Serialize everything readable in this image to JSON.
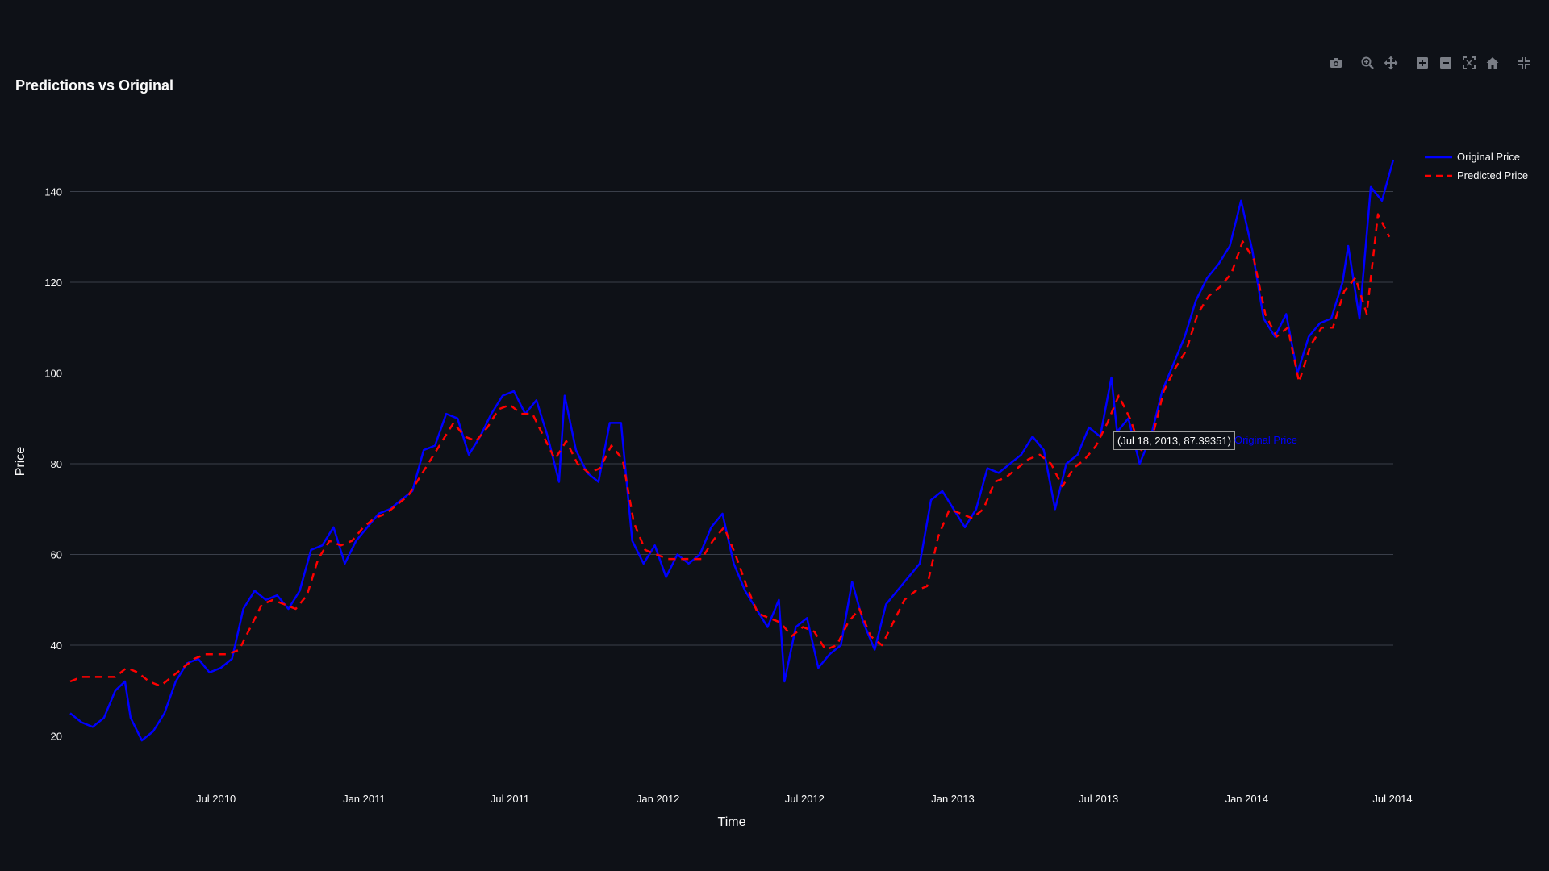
{
  "chart_data": {
    "type": "line",
    "title": "Predictions vs Original",
    "xlabel": "Time",
    "ylabel": "Price",
    "xlim": [
      "2010-01-01",
      "2014-07-02"
    ],
    "ylim": [
      16,
      152
    ],
    "grid": true,
    "legend_position": "top-right",
    "x_ticks": [
      {
        "date": "2010-07-01",
        "label": "Jul 2010"
      },
      {
        "date": "2011-01-01",
        "label": "Jan 2011"
      },
      {
        "date": "2011-07-01",
        "label": "Jul 2011"
      },
      {
        "date": "2012-01-01",
        "label": "Jan 2012"
      },
      {
        "date": "2012-07-01",
        "label": "Jul 2012"
      },
      {
        "date": "2013-01-01",
        "label": "Jan 2013"
      },
      {
        "date": "2013-07-01",
        "label": "Jul 2013"
      },
      {
        "date": "2014-01-01",
        "label": "Jan 2014"
      },
      {
        "date": "2014-07-01",
        "label": "Jul 2014"
      }
    ],
    "y_ticks": [
      20,
      40,
      60,
      80,
      100,
      120,
      140
    ],
    "series": [
      {
        "name": "Original Price",
        "color": "#0000ff",
        "dash": "solid",
        "points": [
          [
            "2010-01-01",
            25
          ],
          [
            "2010-01-15",
            23
          ],
          [
            "2010-01-29",
            22
          ],
          [
            "2010-02-12",
            24
          ],
          [
            "2010-02-26",
            30
          ],
          [
            "2010-03-10",
            32
          ],
          [
            "2010-03-17",
            24
          ],
          [
            "2010-03-31",
            19
          ],
          [
            "2010-04-14",
            21
          ],
          [
            "2010-04-28",
            25
          ],
          [
            "2010-05-12",
            32
          ],
          [
            "2010-05-26",
            36
          ],
          [
            "2010-06-09",
            37
          ],
          [
            "2010-06-23",
            34
          ],
          [
            "2010-07-07",
            35
          ],
          [
            "2010-07-21",
            37
          ],
          [
            "2010-08-04",
            48
          ],
          [
            "2010-08-18",
            52
          ],
          [
            "2010-09-01",
            50
          ],
          [
            "2010-09-15",
            51
          ],
          [
            "2010-09-29",
            48
          ],
          [
            "2010-10-13",
            52
          ],
          [
            "2010-10-27",
            61
          ],
          [
            "2010-11-10",
            62
          ],
          [
            "2010-11-24",
            66
          ],
          [
            "2010-12-08",
            58
          ],
          [
            "2010-12-22",
            63
          ],
          [
            "2011-01-05",
            66
          ],
          [
            "2011-01-19",
            69
          ],
          [
            "2011-02-02",
            70
          ],
          [
            "2011-02-16",
            72
          ],
          [
            "2011-03-02",
            74
          ],
          [
            "2011-03-16",
            83
          ],
          [
            "2011-03-30",
            84
          ],
          [
            "2011-04-13",
            91
          ],
          [
            "2011-04-27",
            90
          ],
          [
            "2011-05-11",
            82
          ],
          [
            "2011-05-25",
            86
          ],
          [
            "2011-06-08",
            91
          ],
          [
            "2011-06-22",
            95
          ],
          [
            "2011-07-06",
            96
          ],
          [
            "2011-07-20",
            91
          ],
          [
            "2011-08-03",
            94
          ],
          [
            "2011-08-17",
            86
          ],
          [
            "2011-08-31",
            76
          ],
          [
            "2011-09-07",
            95
          ],
          [
            "2011-09-21",
            83
          ],
          [
            "2011-10-05",
            78
          ],
          [
            "2011-10-19",
            76
          ],
          [
            "2011-11-02",
            89
          ],
          [
            "2011-11-16",
            89
          ],
          [
            "2011-11-30",
            63
          ],
          [
            "2011-12-14",
            58
          ],
          [
            "2011-12-28",
            62
          ],
          [
            "2012-01-11",
            55
          ],
          [
            "2012-01-25",
            60
          ],
          [
            "2012-02-08",
            58
          ],
          [
            "2012-02-22",
            60
          ],
          [
            "2012-03-07",
            66
          ],
          [
            "2012-03-21",
            69
          ],
          [
            "2012-04-04",
            58
          ],
          [
            "2012-04-18",
            52
          ],
          [
            "2012-05-02",
            48
          ],
          [
            "2012-05-16",
            44
          ],
          [
            "2012-05-30",
            50
          ],
          [
            "2012-06-06",
            32
          ],
          [
            "2012-06-20",
            44
          ],
          [
            "2012-07-04",
            46
          ],
          [
            "2012-07-18",
            35
          ],
          [
            "2012-08-01",
            38
          ],
          [
            "2012-08-15",
            40
          ],
          [
            "2012-08-29",
            54
          ],
          [
            "2012-09-12",
            45
          ],
          [
            "2012-09-26",
            39
          ],
          [
            "2012-10-10",
            49
          ],
          [
            "2012-10-24",
            52
          ],
          [
            "2012-11-07",
            55
          ],
          [
            "2012-11-21",
            58
          ],
          [
            "2012-12-05",
            72
          ],
          [
            "2012-12-19",
            74
          ],
          [
            "2013-01-02",
            70
          ],
          [
            "2013-01-16",
            66
          ],
          [
            "2013-01-30",
            70
          ],
          [
            "2013-02-13",
            79
          ],
          [
            "2013-02-27",
            78
          ],
          [
            "2013-03-13",
            80
          ],
          [
            "2013-03-27",
            82
          ],
          [
            "2013-04-10",
            86
          ],
          [
            "2013-04-24",
            83
          ],
          [
            "2013-05-08",
            70
          ],
          [
            "2013-05-22",
            80
          ],
          [
            "2013-06-05",
            82
          ],
          [
            "2013-06-19",
            88
          ],
          [
            "2013-07-03",
            86
          ],
          [
            "2013-07-17",
            99
          ],
          [
            "2013-07-24",
            87
          ],
          [
            "2013-08-07",
            90
          ],
          [
            "2013-08-21",
            80
          ],
          [
            "2013-09-04",
            86
          ],
          [
            "2013-09-18",
            96
          ],
          [
            "2013-10-02",
            102
          ],
          [
            "2013-10-16",
            108
          ],
          [
            "2013-10-30",
            116
          ],
          [
            "2013-11-13",
            121
          ],
          [
            "2013-11-27",
            124
          ],
          [
            "2013-12-11",
            128
          ],
          [
            "2013-12-25",
            138
          ],
          [
            "2014-01-08",
            127
          ],
          [
            "2014-01-22",
            112
          ],
          [
            "2014-02-05",
            108
          ],
          [
            "2014-02-19",
            113
          ],
          [
            "2014-03-05",
            100
          ],
          [
            "2014-03-19",
            108
          ],
          [
            "2014-04-02",
            111
          ],
          [
            "2014-04-16",
            112
          ],
          [
            "2014-04-30",
            120
          ],
          [
            "2014-05-07",
            128
          ],
          [
            "2014-05-21",
            112
          ],
          [
            "2014-06-04",
            141
          ],
          [
            "2014-06-18",
            138
          ],
          [
            "2014-07-02",
            147
          ]
        ]
      },
      {
        "name": "Predicted Price",
        "color": "#ff0000",
        "dash": "dashed",
        "points": [
          [
            "2010-01-01",
            32
          ],
          [
            "2010-01-15",
            33
          ],
          [
            "2010-01-29",
            33
          ],
          [
            "2010-02-12",
            33
          ],
          [
            "2010-02-26",
            33
          ],
          [
            "2010-03-12",
            35
          ],
          [
            "2010-03-26",
            34
          ],
          [
            "2010-04-09",
            32
          ],
          [
            "2010-04-23",
            31
          ],
          [
            "2010-05-07",
            33
          ],
          [
            "2010-05-21",
            35
          ],
          [
            "2010-06-04",
            37
          ],
          [
            "2010-06-18",
            38
          ],
          [
            "2010-07-02",
            38
          ],
          [
            "2010-07-16",
            38
          ],
          [
            "2010-07-30",
            39
          ],
          [
            "2010-08-13",
            44
          ],
          [
            "2010-08-27",
            49
          ],
          [
            "2010-09-10",
            50
          ],
          [
            "2010-09-24",
            49
          ],
          [
            "2010-10-08",
            48
          ],
          [
            "2010-10-22",
            51
          ],
          [
            "2010-11-05",
            59
          ],
          [
            "2010-11-19",
            63
          ],
          [
            "2010-12-03",
            62
          ],
          [
            "2010-12-17",
            63
          ],
          [
            "2010-12-31",
            66
          ],
          [
            "2011-01-14",
            68
          ],
          [
            "2011-01-28",
            69
          ],
          [
            "2011-02-11",
            71
          ],
          [
            "2011-02-25",
            73
          ],
          [
            "2011-03-11",
            77
          ],
          [
            "2011-03-25",
            81
          ],
          [
            "2011-04-08",
            85
          ],
          [
            "2011-04-22",
            89
          ],
          [
            "2011-05-06",
            86
          ],
          [
            "2011-05-20",
            85
          ],
          [
            "2011-06-03",
            88
          ],
          [
            "2011-06-17",
            92
          ],
          [
            "2011-07-01",
            93
          ],
          [
            "2011-07-15",
            91
          ],
          [
            "2011-07-29",
            91
          ],
          [
            "2011-08-12",
            86
          ],
          [
            "2011-08-26",
            81
          ],
          [
            "2011-09-09",
            85
          ],
          [
            "2011-09-23",
            80
          ],
          [
            "2011-10-07",
            78
          ],
          [
            "2011-10-21",
            79
          ],
          [
            "2011-11-04",
            84
          ],
          [
            "2011-11-18",
            81
          ],
          [
            "2011-12-02",
            67
          ],
          [
            "2011-12-16",
            61
          ],
          [
            "2011-12-30",
            60
          ],
          [
            "2012-01-13",
            59
          ],
          [
            "2012-01-27",
            59
          ],
          [
            "2012-02-10",
            59
          ],
          [
            "2012-02-24",
            59
          ],
          [
            "2012-03-09",
            63
          ],
          [
            "2012-03-23",
            66
          ],
          [
            "2012-04-06",
            60
          ],
          [
            "2012-04-20",
            53
          ],
          [
            "2012-05-04",
            47
          ],
          [
            "2012-05-18",
            46
          ],
          [
            "2012-06-01",
            45
          ],
          [
            "2012-06-15",
            42
          ],
          [
            "2012-06-29",
            44
          ],
          [
            "2012-07-13",
            43
          ],
          [
            "2012-07-27",
            39
          ],
          [
            "2012-08-10",
            40
          ],
          [
            "2012-08-24",
            45
          ],
          [
            "2012-09-07",
            48
          ],
          [
            "2012-09-21",
            42
          ],
          [
            "2012-10-05",
            40
          ],
          [
            "2012-10-19",
            45
          ],
          [
            "2012-11-02",
            50
          ],
          [
            "2012-11-16",
            52
          ],
          [
            "2012-11-30",
            53
          ],
          [
            "2012-12-14",
            64
          ],
          [
            "2012-12-28",
            70
          ],
          [
            "2013-01-11",
            69
          ],
          [
            "2013-01-25",
            68
          ],
          [
            "2013-02-08",
            70
          ],
          [
            "2013-02-22",
            76
          ],
          [
            "2013-03-08",
            77
          ],
          [
            "2013-03-22",
            79
          ],
          [
            "2013-04-05",
            81
          ],
          [
            "2013-04-19",
            82
          ],
          [
            "2013-05-03",
            80
          ],
          [
            "2013-05-17",
            75
          ],
          [
            "2013-05-31",
            79
          ],
          [
            "2013-06-14",
            81
          ],
          [
            "2013-06-28",
            84
          ],
          [
            "2013-07-12",
            89
          ],
          [
            "2013-07-26",
            95
          ],
          [
            "2013-08-09",
            90
          ],
          [
            "2013-08-23",
            83
          ],
          [
            "2013-09-06",
            86
          ],
          [
            "2013-09-20",
            96
          ],
          [
            "2013-10-04",
            101
          ],
          [
            "2013-10-18",
            105
          ],
          [
            "2013-11-01",
            113
          ],
          [
            "2013-11-15",
            117
          ],
          [
            "2013-11-29",
            119
          ],
          [
            "2013-12-13",
            122
          ],
          [
            "2013-12-27",
            129
          ],
          [
            "2014-01-10",
            125
          ],
          [
            "2014-01-24",
            113
          ],
          [
            "2014-02-07",
            108
          ],
          [
            "2014-02-21",
            110
          ],
          [
            "2014-03-07",
            98
          ],
          [
            "2014-03-21",
            106
          ],
          [
            "2014-04-04",
            110
          ],
          [
            "2014-04-18",
            110
          ],
          [
            "2014-05-02",
            118
          ],
          [
            "2014-05-16",
            121
          ],
          [
            "2014-05-30",
            113
          ],
          [
            "2014-06-13",
            135
          ],
          [
            "2014-06-27",
            130
          ]
        ]
      }
    ],
    "hover": {
      "text": "(Jul 18, 2013, 87.39351)",
      "series_name": "Original Price"
    }
  },
  "modebar": [
    {
      "name": "camera-icon",
      "glyph": "camera"
    },
    {
      "name": "zoom-icon",
      "glyph": "zoom"
    },
    {
      "name": "pan-icon",
      "glyph": "pan"
    },
    {
      "name": "zoom-in-icon",
      "glyph": "plus"
    },
    {
      "name": "zoom-out-icon",
      "glyph": "minus"
    },
    {
      "name": "autoscale-icon",
      "glyph": "autoscale"
    },
    {
      "name": "reset-axes-icon",
      "glyph": "home"
    },
    {
      "name": "fullscreen-exit-icon",
      "glyph": "collapse"
    }
  ],
  "colors": {
    "background": "#0e1117",
    "grid": "#3a3f4a",
    "text": "#fafafa",
    "icon": "#7a7e86"
  }
}
